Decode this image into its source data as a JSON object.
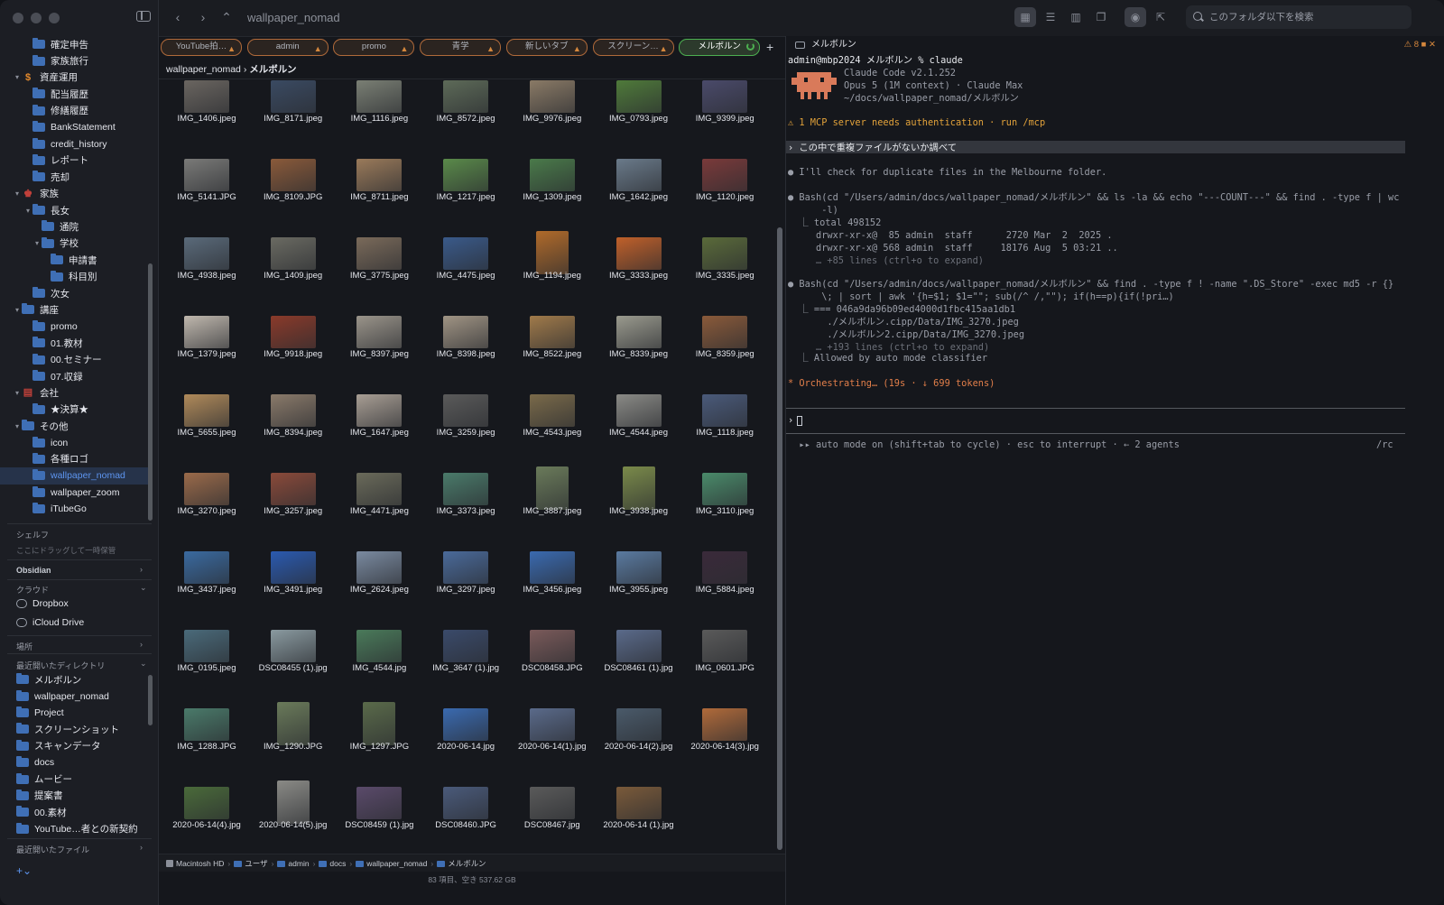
{
  "window": {
    "title": "wallpaper_nomad"
  },
  "sidebar": {
    "tree": [
      {
        "label": "確定申告",
        "indent": 1,
        "arrow": "",
        "icon": "folder"
      },
      {
        "label": "家族旅行",
        "indent": 1,
        "arrow": "",
        "icon": "folder"
      },
      {
        "label": "資産運用",
        "indent": 0,
        "arrow": "▾",
        "icon": "dollar"
      },
      {
        "label": "配当履歴",
        "indent": 1,
        "arrow": "",
        "icon": "folder"
      },
      {
        "label": "修繕履歴",
        "indent": 1,
        "arrow": "",
        "icon": "folder"
      },
      {
        "label": "BankStatement",
        "indent": 1,
        "arrow": "",
        "icon": "folder"
      },
      {
        "label": "credit_history",
        "indent": 1,
        "arrow": "",
        "icon": "folder"
      },
      {
        "label": "レポート",
        "indent": 1,
        "arrow": "",
        "icon": "folder"
      },
      {
        "label": "売却",
        "indent": 1,
        "arrow": "",
        "icon": "folder"
      },
      {
        "label": "家族",
        "indent": 0,
        "arrow": "▾",
        "icon": "family"
      },
      {
        "label": "長女",
        "indent": 1,
        "arrow": "▾",
        "icon": "folder"
      },
      {
        "label": "通院",
        "indent": 2,
        "arrow": "",
        "icon": "folder"
      },
      {
        "label": "学校",
        "indent": 2,
        "arrow": "▾",
        "icon": "folder"
      },
      {
        "label": "申請書",
        "indent": 3,
        "arrow": "",
        "icon": "folder"
      },
      {
        "label": "科目別",
        "indent": 3,
        "arrow": "",
        "icon": "folder"
      },
      {
        "label": "次女",
        "indent": 1,
        "arrow": "",
        "icon": "folder"
      },
      {
        "label": "講座",
        "indent": 0,
        "arrow": "▾",
        "icon": "cloudfolder"
      },
      {
        "label": "promo",
        "indent": 1,
        "arrow": "",
        "icon": "folder"
      },
      {
        "label": "01.教材",
        "indent": 1,
        "arrow": "",
        "icon": "folder"
      },
      {
        "label": "00.セミナー",
        "indent": 1,
        "arrow": "",
        "icon": "folder"
      },
      {
        "label": "07.収録",
        "indent": 1,
        "arrow": "",
        "icon": "folder"
      },
      {
        "label": "会社",
        "indent": 0,
        "arrow": "▾",
        "icon": "company"
      },
      {
        "label": "★決算★",
        "indent": 1,
        "arrow": "",
        "icon": "folder"
      },
      {
        "label": "その他",
        "indent": 0,
        "arrow": "▾",
        "icon": "folder"
      },
      {
        "label": "icon",
        "indent": 1,
        "arrow": "",
        "icon": "folder"
      },
      {
        "label": "各種ロゴ",
        "indent": 1,
        "arrow": "",
        "icon": "folder"
      },
      {
        "label": "wallpaper_nomad",
        "indent": 1,
        "arrow": "",
        "icon": "folder",
        "selected": true
      },
      {
        "label": "wallpaper_zoom",
        "indent": 1,
        "arrow": "",
        "icon": "folder"
      },
      {
        "label": "iTubeGo",
        "indent": 1,
        "arrow": "",
        "icon": "folder"
      }
    ],
    "shelf_title": "シェルフ",
    "shelf_hint": "ここにドラッグして一時保管",
    "obsidian": "Obsidian",
    "cloud_title": "クラウド",
    "dropbox": "Dropbox",
    "icloud": "iCloud Drive",
    "places": "場所",
    "recent_dirs_title": "最近開いたディレクトリ",
    "recent_dirs": [
      "メルボルン",
      "wallpaper_nomad",
      "Project",
      "スクリーンショット",
      "スキャンデータ",
      "docs",
      "ムービー",
      "提案書",
      "00.素材",
      "YouTube…者との新契約"
    ],
    "recent_files": "最近開いたファイル",
    "add": "+⌄"
  },
  "toolbar": {
    "back": "‹",
    "forward": "›",
    "up": "⌃",
    "search_placeholder": "このフォルダ以下を検索"
  },
  "tabs": [
    {
      "label": "YouTube拍…",
      "active": false
    },
    {
      "label": "admin",
      "active": false
    },
    {
      "label": "promo",
      "active": false
    },
    {
      "label": "青学",
      "active": false
    },
    {
      "label": "新しいタブ",
      "active": false
    },
    {
      "label": "スクリーン…",
      "active": false
    },
    {
      "label": "メルボルン",
      "active": true
    }
  ],
  "tab_add": "+",
  "breadcrumb": {
    "parent": "wallpaper_nomad",
    "sep": "›",
    "current": "メルボルン"
  },
  "files": [
    {
      "name": "IMG_1406.jpeg",
      "color": "#6a6560"
    },
    {
      "name": "IMG_8171.jpeg",
      "color": "#3a4a62"
    },
    {
      "name": "IMG_1116.jpeg",
      "color": "#7a7f74"
    },
    {
      "name": "IMG_8572.jpeg",
      "color": "#5d6a58"
    },
    {
      "name": "IMG_9976.jpeg",
      "color": "#8a7a66"
    },
    {
      "name": "IMG_0793.jpeg",
      "color": "#4f7a3a"
    },
    {
      "name": "IMG_9399.jpeg",
      "color": "#4a4a6a"
    },
    {
      "name": "IMG_5141.JPG",
      "color": "#7a7a78"
    },
    {
      "name": "IMG_8109.JPG",
      "color": "#8a5a3a"
    },
    {
      "name": "IMG_8711.jpeg",
      "color": "#9a7a5a"
    },
    {
      "name": "IMG_1217.jpeg",
      "color": "#5a8a4a"
    },
    {
      "name": "IMG_1309.jpeg",
      "color": "#4a7a4a"
    },
    {
      "name": "IMG_1642.jpeg",
      "color": "#6a7a8a"
    },
    {
      "name": "IMG_1120.jpeg",
      "color": "#7a3a3a"
    },
    {
      "name": "IMG_4938.jpeg",
      "color": "#5a6a7a"
    },
    {
      "name": "IMG_1409.jpeg",
      "color": "#6a6a62"
    },
    {
      "name": "IMG_3775.jpeg",
      "color": "#7a6a5a"
    },
    {
      "name": "IMG_4475.jpeg",
      "color": "#3a5a8a"
    },
    {
      "name": "IMG_1194.jpeg",
      "color": "#b06a2a",
      "tall": true
    },
    {
      "name": "IMG_3333.jpeg",
      "color": "#c0602a"
    },
    {
      "name": "IMG_3335.jpeg",
      "color": "#5a6a3a"
    },
    {
      "name": "IMG_1379.jpeg",
      "color": "#c0b8ae"
    },
    {
      "name": "IMG_9918.jpeg",
      "color": "#8a3a2a"
    },
    {
      "name": "IMG_8397.jpeg",
      "color": "#9a948a"
    },
    {
      "name": "IMG_8398.jpeg",
      "color": "#a09484"
    },
    {
      "name": "IMG_8522.jpeg",
      "color": "#a07a4a"
    },
    {
      "name": "IMG_8339.jpeg",
      "color": "#9a9a8e"
    },
    {
      "name": "IMG_8359.jpeg",
      "color": "#8a5a3a"
    },
    {
      "name": "IMG_5655.jpeg",
      "color": "#b08a5a"
    },
    {
      "name": "IMG_8394.jpeg",
      "color": "#8a7a6a"
    },
    {
      "name": "IMG_1647.jpeg",
      "color": "#a89e94"
    },
    {
      "name": "IMG_3259.jpeg",
      "color": "#5a5a5a"
    },
    {
      "name": "IMG_4543.jpeg",
      "color": "#7a6a4a"
    },
    {
      "name": "IMG_4544.jpeg",
      "color": "#8a8a86"
    },
    {
      "name": "IMG_1118.jpeg",
      "color": "#4a5a7a"
    },
    {
      "name": "IMG_3270.jpeg",
      "color": "#9a6a4a"
    },
    {
      "name": "IMG_3257.jpeg",
      "color": "#8a4a3a"
    },
    {
      "name": "IMG_4471.jpeg",
      "color": "#6a6a5a"
    },
    {
      "name": "IMG_3373.jpeg",
      "color": "#4a7a6a"
    },
    {
      "name": "IMG_3887.jpeg",
      "color": "#6a7a5a",
      "tall": true
    },
    {
      "name": "IMG_3938.jpeg",
      "color": "#7a8a4a",
      "tall": true
    },
    {
      "name": "IMG_3110.jpeg",
      "color": "#4a8a6a"
    },
    {
      "name": "IMG_3437.jpeg",
      "color": "#3a6aa0"
    },
    {
      "name": "IMG_3491.jpeg",
      "color": "#2a5ab0"
    },
    {
      "name": "IMG_2624.jpeg",
      "color": "#7a8aa0"
    },
    {
      "name": "IMG_3297.jpeg",
      "color": "#4a6a9a"
    },
    {
      "name": "IMG_3456.jpeg",
      "color": "#3a6ab0"
    },
    {
      "name": "IMG_3955.jpeg",
      "color": "#5a7aa0"
    },
    {
      "name": "IMG_5884.jpeg",
      "color": "#3a2a3a"
    },
    {
      "name": "IMG_0195.jpeg",
      "color": "#4a6a7a"
    },
    {
      "name": "DSC08455 (1).jpg",
      "color": "#8a9aa0"
    },
    {
      "name": "IMG_4544.jpg",
      "color": "#4a7a5a"
    },
    {
      "name": "IMG_3647 (1).jpg",
      "color": "#3a4a6a"
    },
    {
      "name": "DSC08458.JPG",
      "color": "#7a5a5a"
    },
    {
      "name": "DSC08461 (1).jpg",
      "color": "#5a6a8a"
    },
    {
      "name": "IMG_0601.JPG",
      "color": "#5a5a5a"
    },
    {
      "name": "IMG_1288.JPG",
      "color": "#4a7a6a"
    },
    {
      "name": "IMG_1290.JPG",
      "color": "#6a7a5a",
      "tall": true
    },
    {
      "name": "IMG_1297.JPG",
      "color": "#5a6a4a",
      "tall": true
    },
    {
      "name": "2020-06-14.jpg",
      "color": "#3a6ab0"
    },
    {
      "name": "2020-06-14(1).jpg",
      "color": "#5a6a8a"
    },
    {
      "name": "2020-06-14(2).jpg",
      "color": "#4a5a6a"
    },
    {
      "name": "2020-06-14(3).jpg",
      "color": "#b06a3a"
    },
    {
      "name": "2020-06-14(4).jpg",
      "color": "#4a6a3a"
    },
    {
      "name": "2020-06-14(5).jpg",
      "color": "#8a8a86",
      "tall": true
    },
    {
      "name": "DSC08459 (1).jpg",
      "color": "#5a4a6a"
    },
    {
      "name": "DSC08460.JPG",
      "color": "#4a5a7a"
    },
    {
      "name": "DSC08467.jpg",
      "color": "#5a5a5a"
    },
    {
      "name": "2020-06-14 (1).jpg",
      "color": "#7a5a3a"
    }
  ],
  "pathbar": [
    "Macintosh HD",
    "ユーザ",
    "admin",
    "docs",
    "wallpaper_nomad",
    "メルボルン"
  ],
  "status": "83 項目、空き 537.62 GB",
  "terminal": {
    "title": "メルボルン",
    "badge": "8",
    "lines": [
      {
        "t": "admin@mbp2024 メルボルン % claude",
        "c": "c-white"
      },
      {
        "t": "          Claude Code v2.1.252",
        "c": "c-gray"
      },
      {
        "t": "          Opus 5 (1M context) · Claude Max",
        "c": "c-gray"
      },
      {
        "t": "          ~/docs/wallpaper_nomad/メルボルン",
        "c": "c-gray"
      },
      {
        "t": "",
        "c": ""
      },
      {
        "t": "⚠ 1 MCP server needs authentication · run /mcp",
        "c": "c-warn"
      },
      {
        "t": "",
        "c": ""
      },
      {
        "t": "› この中で重複ファイルがないか調べて",
        "c": "c-white"
      },
      {
        "t": "",
        "c": ""
      },
      {
        "t": "● I'll check for duplicate files in the Melbourne folder.",
        "c": "c-gray"
      },
      {
        "t": "",
        "c": ""
      },
      {
        "t": "● Bash(cd \"/Users/admin/docs/wallpaper_nomad/メルボルン\" && ls -la && echo \"---COUNT---\" && find . -type f | wc",
        "c": "c-gray"
      },
      {
        "t": "      -l)",
        "c": "c-gray"
      },
      {
        "t": "  ⎿ total 498152",
        "c": "c-gray"
      },
      {
        "t": "     drwxr-xr-x@  85 admin  staff      2720 Mar  2  2025 .",
        "c": "c-gray"
      },
      {
        "t": "     drwxr-xr-x@ 568 admin  staff     18176 Aug  5 03:21 ..",
        "c": "c-gray"
      },
      {
        "t": "     … +85 lines (ctrl+o to expand)",
        "c": "c-dim"
      },
      {
        "t": "",
        "c": ""
      },
      {
        "t": "● Bash(cd \"/Users/admin/docs/wallpaper_nomad/メルボルン\" && find . -type f ! -name \".DS_Store\" -exec md5 -r {}",
        "c": "c-gray"
      },
      {
        "t": "      \\; | sort | awk '{h=$1; $1=\"\"; sub(/^ /,\"\"); if(h==p){if(!pri…)",
        "c": "c-gray"
      },
      {
        "t": "  ⎿ === 046a9da96b09ed4000d1fbc415aa1db1",
        "c": "c-gray"
      },
      {
        "t": "       ./メルボルン.cipp/Data/IMG_3270.jpeg",
        "c": "c-gray"
      },
      {
        "t": "       ./メルボルン2.cipp/Data/IMG_3270.jpeg",
        "c": "c-gray"
      },
      {
        "t": "     … +193 lines (ctrl+o to expand)",
        "c": "c-dim"
      },
      {
        "t": "  ⎿ Allowed by auto mode classifier",
        "c": "c-gray"
      },
      {
        "t": "",
        "c": ""
      },
      {
        "t": "* Orchestrating… (19s · ↓ 699 tokens)",
        "c": "c-orange"
      }
    ],
    "prompt": "›",
    "footer": "  ▸▸ auto mode on (shift+tab to cycle) · esc to interrupt · ← 2 agents",
    "footer_right": "/rc"
  }
}
